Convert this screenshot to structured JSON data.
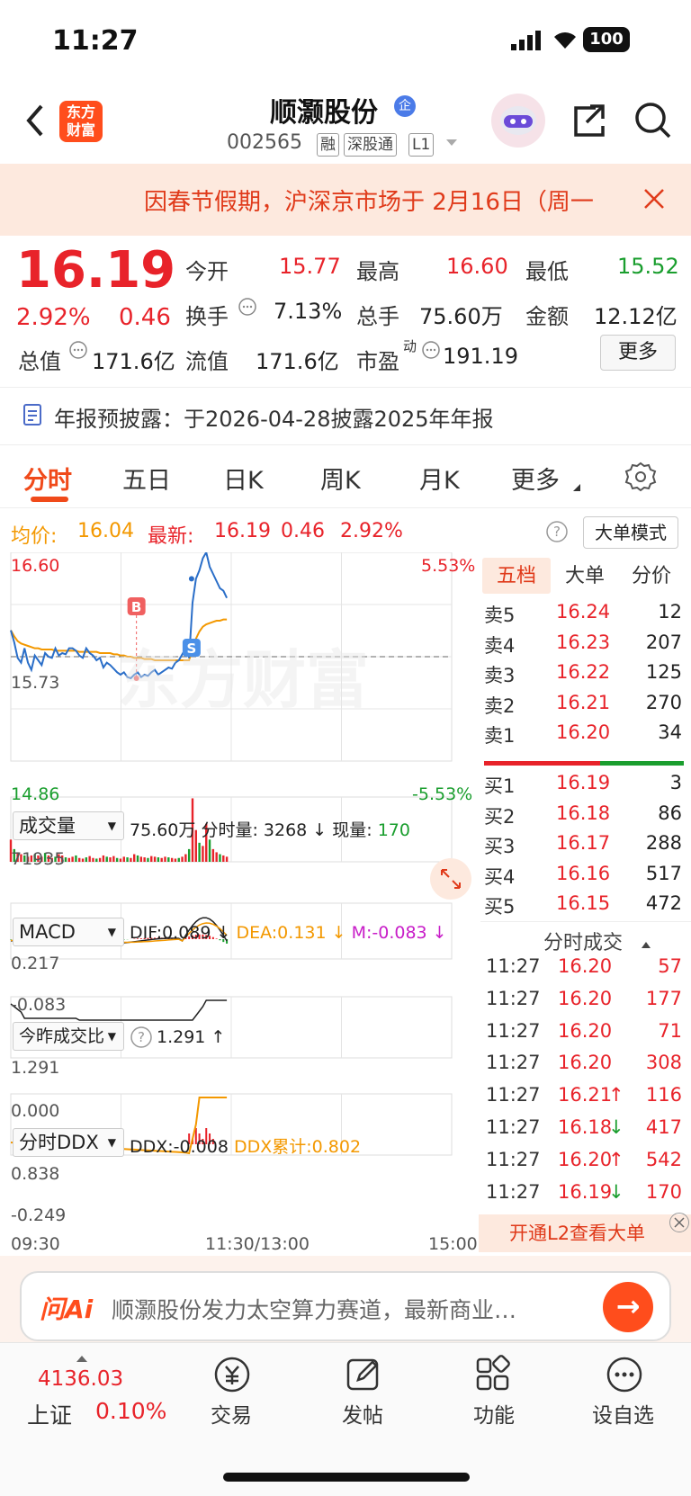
{
  "status_bar": {
    "time": "11:27",
    "battery": "100"
  },
  "header": {
    "logo_line1": "东方",
    "logo_line2": "财富",
    "stock_name": "顺灏股份",
    "name_badge": "企",
    "stock_code": "002565",
    "tags": [
      "融",
      "深股通",
      "L1"
    ]
  },
  "banner": {
    "text": "因春节假期，沪深京市场于 2月16日（周一"
  },
  "quote": {
    "price": "16.19",
    "change_pct": "2.92%",
    "change_amt": "0.46",
    "open_label": "今开",
    "open": "15.77",
    "high_label": "最高",
    "high": "16.60",
    "low_label": "最低",
    "low": "15.52",
    "turnover_label": "换手",
    "turnover": "7.13%",
    "volume_label": "总手",
    "volume": "75.60万",
    "amount_label": "金额",
    "amount": "12.12亿",
    "mktcap_label": "总值",
    "mktcap": "171.6亿",
    "float_label": "流值",
    "float_cap": "171.6亿",
    "pe_label": "市盈",
    "pe_sup": "动",
    "pe": "191.19",
    "more_label": "更多"
  },
  "notice": {
    "text": "年报预披露：于2026-04-28披露2025年年报"
  },
  "tabs": [
    {
      "label": "分时",
      "active": true
    },
    {
      "label": "五日",
      "active": false
    },
    {
      "label": "日K",
      "active": false
    },
    {
      "label": "周K",
      "active": false
    },
    {
      "label": "月K",
      "active": false
    },
    {
      "label": "更多",
      "active": false
    }
  ],
  "info_line": {
    "avg_label": "均价:",
    "avg": "16.04",
    "latest_label": "最新:",
    "latest": "16.19",
    "chg": "0.46",
    "pct": "2.92%",
    "mode_button": "大单模式"
  },
  "chart_data": [
    {
      "type": "line",
      "name": "intraday",
      "y_max": "16.60",
      "y_min": "14.86",
      "pct_max": "5.53%",
      "pct_min": "-5.53%",
      "prev_close": "15.73",
      "ylim": [
        14.86,
        16.6
      ],
      "x_ticks": [
        "09:30",
        "11:30/13:00",
        "15:00"
      ],
      "markers": [
        {
          "label": "B",
          "x": 0.28,
          "price": 15.55
        },
        {
          "label": "S",
          "x": 0.41,
          "price": 16.4
        }
      ],
      "price": [
        15.95,
        15.85,
        15.72,
        15.68,
        15.8,
        15.68,
        15.62,
        15.74,
        15.7,
        15.66,
        15.76,
        15.73,
        15.72,
        15.8,
        15.74,
        15.76,
        15.75,
        15.8,
        15.8,
        15.78,
        15.74,
        15.72,
        15.8,
        15.76,
        15.74,
        15.7,
        15.72,
        15.64,
        15.68,
        15.66,
        15.63,
        15.6,
        15.58,
        15.6,
        15.56,
        15.55,
        15.58,
        15.6,
        15.56,
        15.58,
        15.57,
        15.6,
        15.62,
        15.58,
        15.6,
        15.62,
        15.64,
        15.63,
        15.68,
        15.7,
        15.75,
        15.8,
        15.72,
        16.18,
        16.38,
        16.45,
        16.55,
        16.6,
        16.48,
        16.42,
        16.36,
        16.3,
        16.28,
        16.22
      ],
      "avg": [
        15.95,
        15.9,
        15.86,
        15.84,
        15.83,
        15.82,
        15.81,
        15.8,
        15.8,
        15.79,
        15.79,
        15.79,
        15.79,
        15.78,
        15.78,
        15.78,
        15.78,
        15.78,
        15.78,
        15.78,
        15.77,
        15.77,
        15.77,
        15.77,
        15.77,
        15.77,
        15.76,
        15.76,
        15.76,
        15.76,
        15.75,
        15.75,
        15.74,
        15.74,
        15.73,
        15.73,
        15.72,
        15.72,
        15.72,
        15.71,
        15.71,
        15.71,
        15.7,
        15.7,
        15.7,
        15.7,
        15.7,
        15.7,
        15.7,
        15.7,
        15.7,
        15.7,
        15.7,
        15.8,
        15.88,
        15.94,
        15.98,
        16.0,
        16.01,
        16.02,
        16.03,
        16.03,
        16.04,
        16.04
      ]
    },
    {
      "type": "bar",
      "name": "volume",
      "title": "成交量",
      "ymax_label": "71935",
      "total": "75.60万",
      "tick_label": "分时量:",
      "tick_vol": "3268",
      "now_label": "现量:",
      "now_vol": "170",
      "values": [
        0.35,
        0.2,
        0.15,
        0.12,
        0.1,
        0.08,
        0.1,
        0.12,
        0.1,
        0.08,
        0.14,
        0.1,
        0.06,
        0.08,
        0.12,
        0.1,
        0.07,
        0.06,
        0.08,
        0.1,
        0.06,
        0.05,
        0.07,
        0.09,
        0.06,
        0.05,
        0.06,
        0.1,
        0.08,
        0.07,
        0.09,
        0.06,
        0.05,
        0.08,
        0.07,
        0.06,
        0.12,
        0.1,
        0.08,
        0.07,
        0.06,
        0.09,
        0.08,
        0.07,
        0.06,
        0.08,
        0.07,
        0.06,
        0.05,
        0.06,
        0.08,
        0.12,
        0.2,
        1.0,
        0.5,
        0.3,
        0.25,
        0.6,
        0.35,
        0.2,
        0.15,
        0.12,
        0.1,
        0.08
      ]
    },
    {
      "type": "line",
      "name": "MACD",
      "title": "MACD",
      "y_top": "0.217",
      "y_bottom": "-0.083",
      "dif": "DIF:0.089",
      "dea": "DEA:0.131",
      "m": "M:-0.083"
    },
    {
      "type": "line",
      "name": "vol_ratio",
      "title": "今昨成交比",
      "value": "1.291",
      "y_top": "1.291",
      "y_bottom": "0.000"
    },
    {
      "type": "line",
      "name": "DDX",
      "title": "分时DDX",
      "ddx": "DDX:-0.008",
      "ddx_sum": "DDX累计:0.802",
      "y_top": "0.838",
      "y_bottom": "-0.249"
    }
  ],
  "orderbook": {
    "tabs": [
      "五档",
      "大单",
      "分价"
    ],
    "asks": [
      {
        "label": "卖5",
        "price": "16.24",
        "vol": "12"
      },
      {
        "label": "卖4",
        "price": "16.23",
        "vol": "207"
      },
      {
        "label": "卖3",
        "price": "16.22",
        "vol": "125"
      },
      {
        "label": "卖2",
        "price": "16.21",
        "vol": "270"
      },
      {
        "label": "卖1",
        "price": "16.20",
        "vol": "34"
      }
    ],
    "bids": [
      {
        "label": "买1",
        "price": "16.19",
        "vol": "3"
      },
      {
        "label": "买2",
        "price": "16.18",
        "vol": "86"
      },
      {
        "label": "买3",
        "price": "16.17",
        "vol": "288"
      },
      {
        "label": "买4",
        "price": "16.16",
        "vol": "517"
      },
      {
        "label": "买5",
        "price": "16.15",
        "vol": "472"
      }
    ],
    "ask_ratio": 0.58
  },
  "trades": {
    "title": "分时成交",
    "rows": [
      {
        "time": "11:27",
        "price": "16.20",
        "dir": "",
        "vol": "57"
      },
      {
        "time": "11:27",
        "price": "16.20",
        "dir": "",
        "vol": "177"
      },
      {
        "time": "11:27",
        "price": "16.20",
        "dir": "",
        "vol": "71"
      },
      {
        "time": "11:27",
        "price": "16.20",
        "dir": "",
        "vol": "308"
      },
      {
        "time": "11:27",
        "price": "16.21",
        "dir": "↑",
        "vol": "116"
      },
      {
        "time": "11:27",
        "price": "16.18",
        "dir": "↓",
        "vol": "417"
      },
      {
        "time": "11:27",
        "price": "16.20",
        "dir": "↑",
        "vol": "542"
      },
      {
        "time": "11:27",
        "price": "16.19",
        "dir": "↓",
        "vol": "170"
      }
    ],
    "l2_text": "开通L2查看大单"
  },
  "ai_bar": {
    "logo": "问Ai",
    "text": "顺灏股份发力太空算力赛道，最新商业…",
    "button": "→"
  },
  "bottom_nav": {
    "index_value": "4136.03",
    "index_name": "上证",
    "index_pct": "0.10%",
    "items": [
      "交易",
      "发帖",
      "功能",
      "设自选"
    ]
  }
}
